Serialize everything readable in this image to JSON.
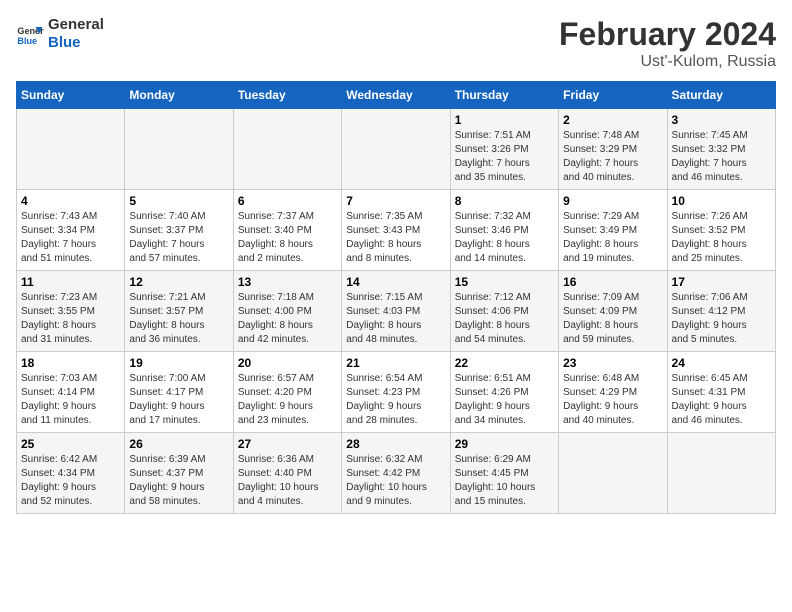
{
  "header": {
    "logo_line1": "General",
    "logo_line2": "Blue",
    "title": "February 2024",
    "subtitle": "Ust'-Kulom, Russia"
  },
  "weekdays": [
    "Sunday",
    "Monday",
    "Tuesday",
    "Wednesday",
    "Thursday",
    "Friday",
    "Saturday"
  ],
  "weeks": [
    [
      {
        "day": "",
        "info": ""
      },
      {
        "day": "",
        "info": ""
      },
      {
        "day": "",
        "info": ""
      },
      {
        "day": "",
        "info": ""
      },
      {
        "day": "1",
        "info": "Sunrise: 7:51 AM\nSunset: 3:26 PM\nDaylight: 7 hours\nand 35 minutes."
      },
      {
        "day": "2",
        "info": "Sunrise: 7:48 AM\nSunset: 3:29 PM\nDaylight: 7 hours\nand 40 minutes."
      },
      {
        "day": "3",
        "info": "Sunrise: 7:45 AM\nSunset: 3:32 PM\nDaylight: 7 hours\nand 46 minutes."
      }
    ],
    [
      {
        "day": "4",
        "info": "Sunrise: 7:43 AM\nSunset: 3:34 PM\nDaylight: 7 hours\nand 51 minutes."
      },
      {
        "day": "5",
        "info": "Sunrise: 7:40 AM\nSunset: 3:37 PM\nDaylight: 7 hours\nand 57 minutes."
      },
      {
        "day": "6",
        "info": "Sunrise: 7:37 AM\nSunset: 3:40 PM\nDaylight: 8 hours\nand 2 minutes."
      },
      {
        "day": "7",
        "info": "Sunrise: 7:35 AM\nSunset: 3:43 PM\nDaylight: 8 hours\nand 8 minutes."
      },
      {
        "day": "8",
        "info": "Sunrise: 7:32 AM\nSunset: 3:46 PM\nDaylight: 8 hours\nand 14 minutes."
      },
      {
        "day": "9",
        "info": "Sunrise: 7:29 AM\nSunset: 3:49 PM\nDaylight: 8 hours\nand 19 minutes."
      },
      {
        "day": "10",
        "info": "Sunrise: 7:26 AM\nSunset: 3:52 PM\nDaylight: 8 hours\nand 25 minutes."
      }
    ],
    [
      {
        "day": "11",
        "info": "Sunrise: 7:23 AM\nSunset: 3:55 PM\nDaylight: 8 hours\nand 31 minutes."
      },
      {
        "day": "12",
        "info": "Sunrise: 7:21 AM\nSunset: 3:57 PM\nDaylight: 8 hours\nand 36 minutes."
      },
      {
        "day": "13",
        "info": "Sunrise: 7:18 AM\nSunset: 4:00 PM\nDaylight: 8 hours\nand 42 minutes."
      },
      {
        "day": "14",
        "info": "Sunrise: 7:15 AM\nSunset: 4:03 PM\nDaylight: 8 hours\nand 48 minutes."
      },
      {
        "day": "15",
        "info": "Sunrise: 7:12 AM\nSunset: 4:06 PM\nDaylight: 8 hours\nand 54 minutes."
      },
      {
        "day": "16",
        "info": "Sunrise: 7:09 AM\nSunset: 4:09 PM\nDaylight: 8 hours\nand 59 minutes."
      },
      {
        "day": "17",
        "info": "Sunrise: 7:06 AM\nSunset: 4:12 PM\nDaylight: 9 hours\nand 5 minutes."
      }
    ],
    [
      {
        "day": "18",
        "info": "Sunrise: 7:03 AM\nSunset: 4:14 PM\nDaylight: 9 hours\nand 11 minutes."
      },
      {
        "day": "19",
        "info": "Sunrise: 7:00 AM\nSunset: 4:17 PM\nDaylight: 9 hours\nand 17 minutes."
      },
      {
        "day": "20",
        "info": "Sunrise: 6:57 AM\nSunset: 4:20 PM\nDaylight: 9 hours\nand 23 minutes."
      },
      {
        "day": "21",
        "info": "Sunrise: 6:54 AM\nSunset: 4:23 PM\nDaylight: 9 hours\nand 28 minutes."
      },
      {
        "day": "22",
        "info": "Sunrise: 6:51 AM\nSunset: 4:26 PM\nDaylight: 9 hours\nand 34 minutes."
      },
      {
        "day": "23",
        "info": "Sunrise: 6:48 AM\nSunset: 4:29 PM\nDaylight: 9 hours\nand 40 minutes."
      },
      {
        "day": "24",
        "info": "Sunrise: 6:45 AM\nSunset: 4:31 PM\nDaylight: 9 hours\nand 46 minutes."
      }
    ],
    [
      {
        "day": "25",
        "info": "Sunrise: 6:42 AM\nSunset: 4:34 PM\nDaylight: 9 hours\nand 52 minutes."
      },
      {
        "day": "26",
        "info": "Sunrise: 6:39 AM\nSunset: 4:37 PM\nDaylight: 9 hours\nand 58 minutes."
      },
      {
        "day": "27",
        "info": "Sunrise: 6:36 AM\nSunset: 4:40 PM\nDaylight: 10 hours\nand 4 minutes."
      },
      {
        "day": "28",
        "info": "Sunrise: 6:32 AM\nSunset: 4:42 PM\nDaylight: 10 hours\nand 9 minutes."
      },
      {
        "day": "29",
        "info": "Sunrise: 6:29 AM\nSunset: 4:45 PM\nDaylight: 10 hours\nand 15 minutes."
      },
      {
        "day": "",
        "info": ""
      },
      {
        "day": "",
        "info": ""
      }
    ]
  ]
}
